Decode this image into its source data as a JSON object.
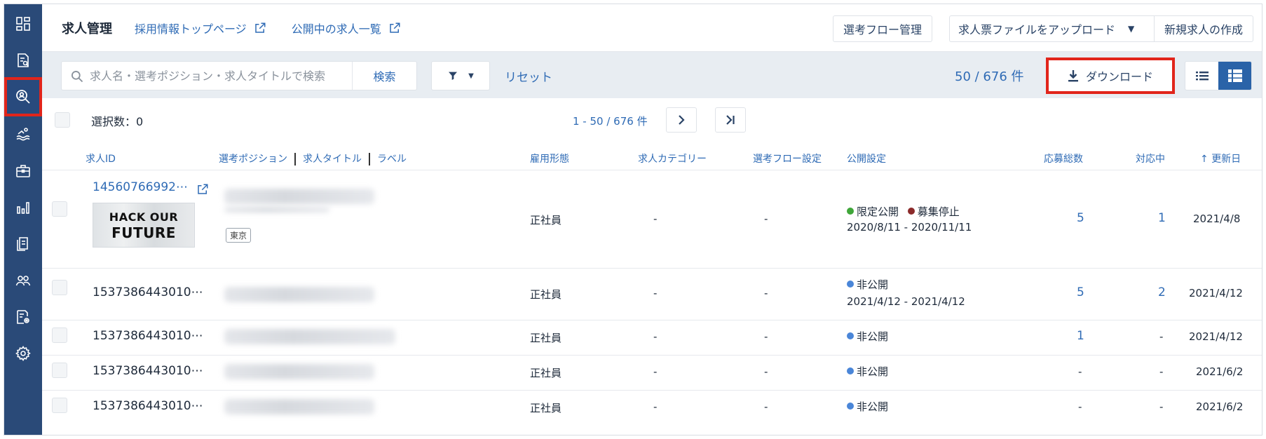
{
  "sidebar": {
    "items": [
      {
        "name": "dashboard-icon"
      },
      {
        "name": "document-search-icon"
      },
      {
        "name": "candidate-search-icon",
        "highlighted": true
      },
      {
        "name": "swimmer-icon"
      },
      {
        "name": "briefcase-icon"
      },
      {
        "name": "bar-chart-icon"
      },
      {
        "name": "documents-icon"
      },
      {
        "name": "users-icon"
      },
      {
        "name": "document-settings-icon"
      },
      {
        "name": "gear-icon"
      }
    ]
  },
  "header": {
    "title": "求人管理",
    "links": [
      "採用情報トップページ",
      "公開中の求人一覧"
    ],
    "flow_button": "選考フロー管理",
    "upload_button": "求人票ファイルをアップロード",
    "create_button": "新規求人の作成"
  },
  "toolbar": {
    "search_placeholder": "求人名・選考ポジション・求人タイトルで検索",
    "search_button": "検索",
    "reset": "リセット",
    "count": "50 / 676 件",
    "download": "ダウンロード"
  },
  "selection": {
    "label": "選択数：0",
    "range": "1 - 50 / 676 件"
  },
  "table": {
    "headers": {
      "id": "求人ID",
      "position": "選考ポジション",
      "job_title": "求人タイトル",
      "label": "ラベル",
      "employment": "雇用形態",
      "category": "求人カテゴリー",
      "flow": "選考フロー設定",
      "publish": "公開設定",
      "applications": "応募総数",
      "in_progress": "対応中",
      "updated": "更新日"
    },
    "rows": [
      {
        "id": "14560766992⋯",
        "tag": "東京",
        "thumb_line1": "HACK OUR",
        "thumb_line2": "FUTURE",
        "employment": "正社員",
        "category": "-",
        "flow": "-",
        "status1": "限定公開",
        "status1_color": "#3fa639",
        "status2": "募集停止",
        "status2_color": "#8b2a2a",
        "period": "2020/8/11 - 2020/11/11",
        "applications": "5",
        "in_progress": "1",
        "updated": "2021/4/8"
      },
      {
        "id": "1537386443010⋯",
        "employment": "正社員",
        "category": "-",
        "flow": "-",
        "status1": "非公開",
        "status1_color": "#4a86d8",
        "period": "2021/4/12 - 2021/4/12",
        "applications": "5",
        "in_progress": "2",
        "updated": "2021/4/12"
      },
      {
        "id": "1537386443010⋯",
        "employment": "正社員",
        "category": "-",
        "flow": "-",
        "status1": "非公開",
        "status1_color": "#4a86d8",
        "applications": "1",
        "in_progress": "-",
        "updated": "2021/4/12"
      },
      {
        "id": "1537386443010⋯",
        "employment": "正社員",
        "category": "-",
        "flow": "-",
        "status1": "非公開",
        "status1_color": "#4a86d8",
        "applications": "-",
        "in_progress": "-",
        "updated": "2021/6/2"
      },
      {
        "id": "1537386443010⋯",
        "employment": "正社員",
        "category": "-",
        "flow": "-",
        "status1": "非公開",
        "status1_color": "#4a86d8",
        "applications": "-",
        "in_progress": "-",
        "updated": "2021/6/2"
      }
    ]
  },
  "colors": {
    "sidebar": "#2a4a78",
    "accent": "#2f6bb5",
    "highlight": "#e1251b",
    "toolbar": "#e8edf2"
  }
}
